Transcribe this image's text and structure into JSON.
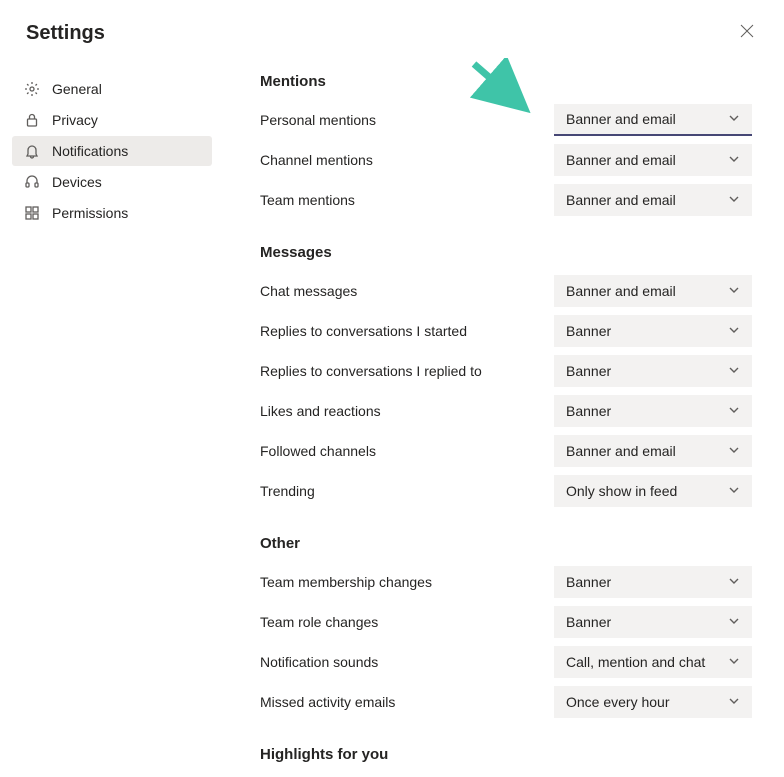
{
  "title": "Settings",
  "sidebar": {
    "items": [
      {
        "name": "general",
        "label": "General"
      },
      {
        "name": "privacy",
        "label": "Privacy"
      },
      {
        "name": "notifications",
        "label": "Notifications"
      },
      {
        "name": "devices",
        "label": "Devices"
      },
      {
        "name": "permissions",
        "label": "Permissions"
      }
    ]
  },
  "sections": {
    "mentions": {
      "title": "Mentions"
    },
    "messages": {
      "title": "Messages"
    },
    "other": {
      "title": "Other"
    },
    "highlights": {
      "title": "Highlights for you"
    }
  },
  "settings": {
    "personal_mentions": {
      "label": "Personal mentions",
      "value": "Banner and email"
    },
    "channel_mentions": {
      "label": "Channel mentions",
      "value": "Banner and email"
    },
    "team_mentions": {
      "label": "Team mentions",
      "value": "Banner and email"
    },
    "chat_messages": {
      "label": "Chat messages",
      "value": "Banner and email"
    },
    "replies_started": {
      "label": "Replies to conversations I started",
      "value": "Banner"
    },
    "replies_replied": {
      "label": "Replies to conversations I replied to",
      "value": "Banner"
    },
    "likes": {
      "label": "Likes and reactions",
      "value": "Banner"
    },
    "followed": {
      "label": "Followed channels",
      "value": "Banner and email"
    },
    "trending": {
      "label": "Trending",
      "value": "Only show in feed"
    },
    "membership": {
      "label": "Team membership changes",
      "value": "Banner"
    },
    "role": {
      "label": "Team role changes",
      "value": "Banner"
    },
    "sounds": {
      "label": "Notification sounds",
      "value": "Call, mention and chat"
    },
    "missed": {
      "label": "Missed activity emails",
      "value": "Once every hour"
    }
  },
  "annotation_arrow_color": "#3fc4a8"
}
